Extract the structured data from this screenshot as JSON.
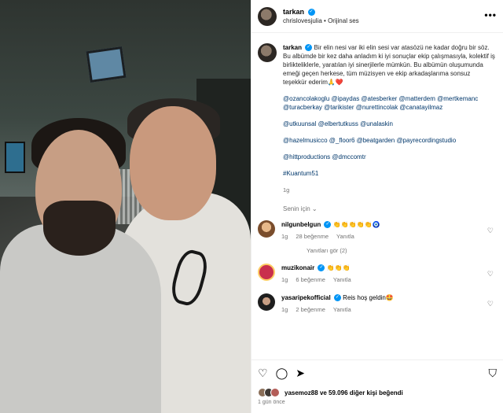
{
  "header": {
    "username": "tarkan",
    "subline_user": "chrislovesjulia",
    "subline_separator": "•",
    "audio": "Orijinal ses",
    "more": "•••"
  },
  "caption": {
    "username": "tarkan",
    "text": "Bir elin nesi var iki elin sesi var atasözü ne kadar doğru bir söz. Bu albümde bir kez daha anladım ki iyi sonuçlar ekip çalışmasıyla, kolektif iş birlikteliklerle, yaratılan iyi sinerjilerle mümkün. Bu albümün oluşumunda emeği geçen herkese, tüm müzisyen ve ekip arkadaşlarıma sonsuz teşekkür ederim🙏❤️",
    "mentions": [
      "@ozancolakoglu @ipaydas @atesberker @matterdem @mertkemanc @turacberkay @tarikister @nurettincolak @canatayilmaz",
      "@utkuunsal @elbertutkuss @unalaskin",
      "@hazelmusicco @_floor6 @beatgarden @payrecordingstudio",
      "@hittproductions @dmccomtr",
      "#Kuantum51"
    ],
    "time": "1g"
  },
  "translate": "Senin için ⌄",
  "comments": [
    {
      "username": "nilgunbelgun",
      "text": "👏👏👏👏👏🧿",
      "time": "1g",
      "likes": "28 beğenme",
      "reply": "Yanıtla"
    },
    {
      "username": "muzikonair",
      "text": "👏👏👏",
      "time": "1g",
      "likes": "6 beğenme",
      "reply": "Yanıtla"
    },
    {
      "username": "yasaripekofficial",
      "text": "Reis hoş geldin🤩",
      "time": "1g",
      "likes": "2 beğenme",
      "reply": "Yanıtla"
    }
  ],
  "replies_label": "Yanıtları gör (2)",
  "bottom": {
    "liked_by_user": "yasemoz88",
    "liked_by_rest": "ve 59.096 diğer kişi beğendi",
    "date": "1 gün önce"
  },
  "icons": [
    "heart-icon",
    "comment-icon",
    "share-icon",
    "save-icon",
    "more-icon",
    "verified-icon"
  ]
}
